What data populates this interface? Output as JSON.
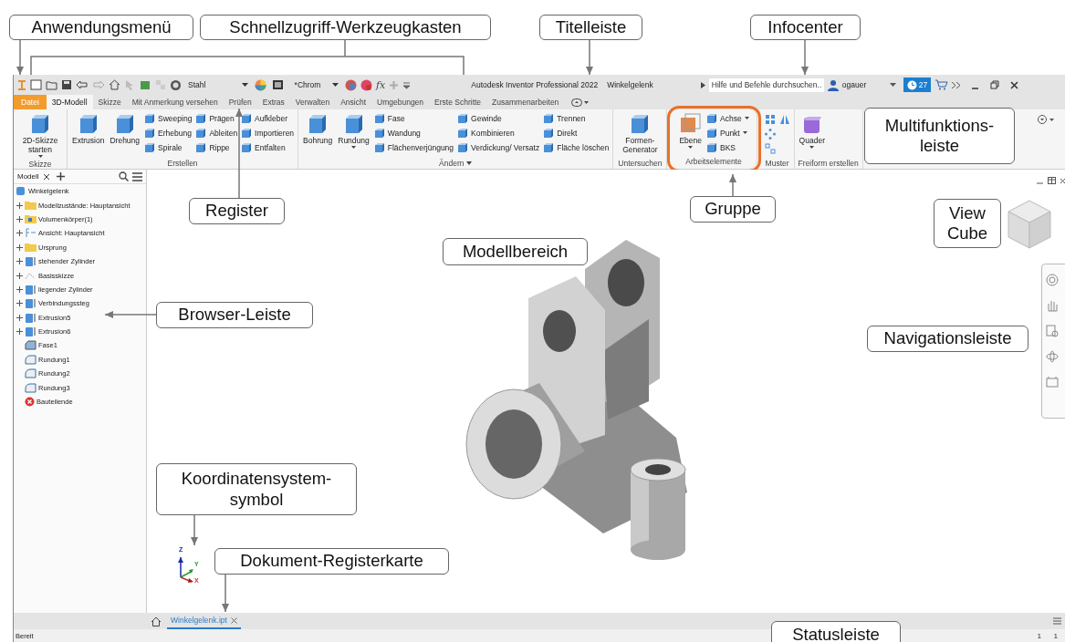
{
  "quick_access": {
    "material": "Stahl",
    "appearance": "*Chrom",
    "formula_symbol": "fx"
  },
  "title_bar": {
    "app_title": "Autodesk Inventor Professional 2022",
    "document": "Winkelgelenk"
  },
  "infocenter": {
    "search": {
      "placeholder": "Hilfe und Befehle durchsuchen.."
    },
    "user": "ogauer",
    "notification_count": "27"
  },
  "tabs": [
    {
      "label": "Datei",
      "kind": "file",
      "selected": false
    },
    {
      "label": "3D-Modell",
      "kind": "ribbon",
      "selected": true
    },
    {
      "label": "Skizze",
      "kind": "ribbon",
      "selected": false
    },
    {
      "label": "Mit Anmerkung versehen",
      "kind": "ribbon",
      "selected": false
    },
    {
      "label": "Prüfen",
      "kind": "ribbon",
      "selected": false
    },
    {
      "label": "Extras",
      "kind": "ribbon",
      "selected": false
    },
    {
      "label": "Verwalten",
      "kind": "ribbon",
      "selected": false
    },
    {
      "label": "Ansicht",
      "kind": "ribbon",
      "selected": false
    },
    {
      "label": "Umgebungen",
      "kind": "ribbon",
      "selected": false
    },
    {
      "label": "Erste Schritte",
      "kind": "ribbon",
      "selected": false
    },
    {
      "label": "Zusammenarbeiten",
      "kind": "ribbon",
      "selected": false
    }
  ],
  "ribbon": {
    "groups": [
      {
        "label": "Skizze",
        "kind": "tools",
        "menu": false,
        "highlighted": false,
        "large": [
          {
            "label": "2D-Skizze starten",
            "dropdown": true
          }
        ]
      },
      {
        "label": "Erstellen",
        "kind": "tools",
        "menu": false,
        "highlighted": false,
        "large": [
          {
            "label": "Extrusion",
            "dropdown": false
          },
          {
            "label": "Drehung",
            "dropdown": false
          }
        ],
        "columns": [
          [
            {
              "label": "Sweeping",
              "dropdown": false
            },
            {
              "label": "Erhebung",
              "dropdown": false
            },
            {
              "label": "Spirale",
              "dropdown": false
            }
          ],
          [
            {
              "label": "Prägen",
              "dropdown": false
            },
            {
              "label": "Ableiten",
              "dropdown": false
            },
            {
              "label": "Rippe",
              "dropdown": false
            }
          ],
          [
            {
              "label": "Aufkleber",
              "dropdown": false
            },
            {
              "label": "Importieren",
              "dropdown": false
            },
            {
              "label": "Entfalten",
              "dropdown": false
            }
          ]
        ]
      },
      {
        "label": "Ändern",
        "kind": "tools",
        "menu": true,
        "highlighted": false,
        "large": [
          {
            "label": "Bohrung",
            "dropdown": false
          },
          {
            "label": "Rundung",
            "dropdown": true
          }
        ],
        "columns": [
          [
            {
              "label": "Fase",
              "dropdown": false
            },
            {
              "label": "Wandung",
              "dropdown": false
            },
            {
              "label": "Flächenverjüngung",
              "dropdown": false
            }
          ],
          [
            {
              "label": "Gewinde",
              "dropdown": false
            },
            {
              "label": "Kombinieren",
              "dropdown": false
            },
            {
              "label": "Verdickung/ Versatz",
              "dropdown": false
            }
          ],
          [
            {
              "label": "Trennen",
              "dropdown": false
            },
            {
              "label": "Direkt",
              "dropdown": false
            },
            {
              "label": "Fläche löschen",
              "dropdown": false
            }
          ]
        ]
      },
      {
        "label": "Untersuchen",
        "kind": "tools",
        "menu": false,
        "highlighted": false,
        "large": [
          {
            "label": "Formen-Generator",
            "dropdown": false
          }
        ]
      },
      {
        "label": "Arbeitselemente",
        "kind": "tools",
        "menu": false,
        "highlighted": true,
        "large": [
          {
            "label": "Ebene",
            "dropdown": true
          }
        ],
        "columns": [
          [
            {
              "label": "Achse",
              "dropdown": true
            },
            {
              "label": "Punkt",
              "dropdown": true
            },
            {
              "label": "BKS",
              "dropdown": false
            }
          ]
        ]
      },
      {
        "label": "Muster",
        "kind": "icons",
        "menu": false,
        "highlighted": false
      },
      {
        "label": "Freiform erstellen",
        "kind": "tools",
        "menu": false,
        "highlighted": false,
        "large": [
          {
            "label": "Quader",
            "dropdown": true
          }
        ]
      }
    ]
  },
  "browser": {
    "tab": "Modell",
    "root": {
      "label": "Winkelgelenk",
      "children": [
        {
          "label": "Modellzustände: Hauptansicht",
          "kind": "folder",
          "expandable": true
        },
        {
          "label": "Volumenkörper(1)",
          "kind": "bodies",
          "expandable": true
        },
        {
          "label": "Ansicht: Hauptansicht",
          "kind": "view",
          "expandable": true
        },
        {
          "label": "Ursprung",
          "kind": "folder",
          "expandable": true
        },
        {
          "label": "stehender Zylinder",
          "kind": "extrusion",
          "expandable": true
        },
        {
          "label": "Basisskizze",
          "kind": "sketch",
          "expandable": true
        },
        {
          "label": "liegender Zylinder",
          "kind": "extrusion",
          "expandable": true
        },
        {
          "label": "Verbindungssteg",
          "kind": "extrusion",
          "expandable": true
        },
        {
          "label": "Extrusion5",
          "kind": "extrusion",
          "expandable": true
        },
        {
          "label": "Extrusion6",
          "kind": "extrusion",
          "expandable": true
        },
        {
          "label": "Fase1",
          "kind": "chamfer",
          "expandable": false
        },
        {
          "label": "Rundung1",
          "kind": "fillet",
          "expandable": false
        },
        {
          "label": "Rundung2",
          "kind": "fillet",
          "expandable": false
        },
        {
          "label": "Rundung3",
          "kind": "fillet",
          "expandable": false
        },
        {
          "label": "Bauteilende",
          "kind": "end",
          "expandable": false
        }
      ]
    }
  },
  "viewport": {
    "axes": [
      "Z",
      "Y",
      "X"
    ]
  },
  "document_tabs": [
    {
      "label": "Winkelgelenk.ipt",
      "selected": true
    }
  ],
  "status_bar": {
    "text": "Bereit",
    "counters": [
      "1",
      "1"
    ]
  },
  "callouts": [
    {
      "text": "Anwendungsmenü"
    },
    {
      "text": "Schnellzugriff-Werkzeugkasten"
    },
    {
      "text": "Titelleiste"
    },
    {
      "text": "Infocenter"
    },
    {
      "text": "Multifunktions-\nleiste"
    },
    {
      "text": "Register"
    },
    {
      "text": "Gruppe"
    },
    {
      "text": "View\nCube"
    },
    {
      "text": "Modellbereich"
    },
    {
      "text": "Browser-Leiste"
    },
    {
      "text": "Navigationsleiste"
    },
    {
      "text": "Koordinatensystem-\nsymbol"
    },
    {
      "text": "Dokument-Registerkarte"
    },
    {
      "text": "Statusleiste"
    }
  ]
}
